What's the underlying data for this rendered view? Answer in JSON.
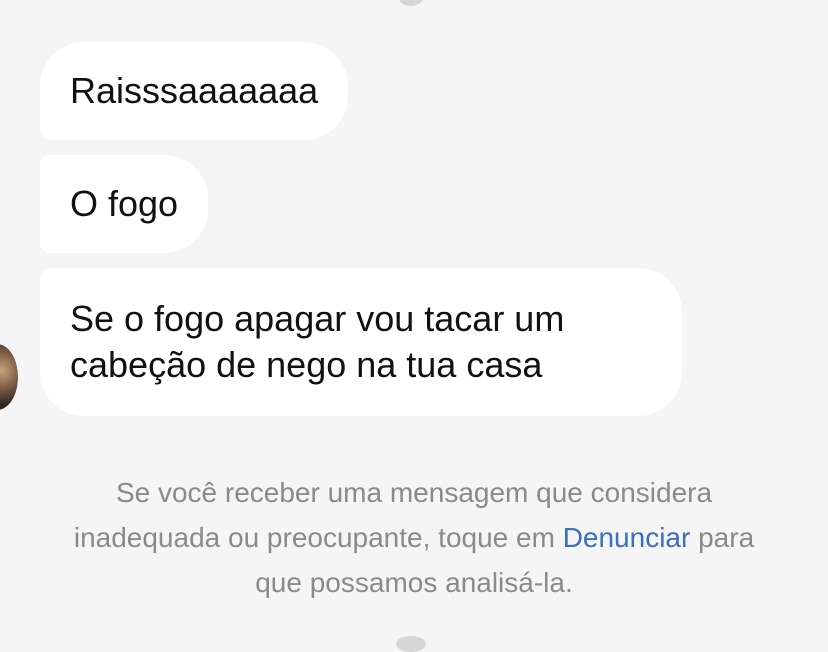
{
  "messages": [
    {
      "text": "Raisssaaaaaaa"
    },
    {
      "text": "O fogo"
    },
    {
      "lines": [
        "Se o fogo apagar vou tacar um",
        "cabeção de nego na tua casa"
      ]
    }
  ],
  "notice": {
    "line1": "Se você receber uma mensagem que considera",
    "line2_before": "inadequada ou preocupante, toque em ",
    "report_link": "Denunciar",
    "line2_after": " para",
    "line3": "que possamos analisá-la."
  },
  "colors": {
    "background": "#f5f5f5",
    "bubble": "#ffffff",
    "notice_text": "#8a8a8a",
    "link": "#3a6fbf"
  },
  "icons": {
    "avatar": "sender-avatar"
  }
}
